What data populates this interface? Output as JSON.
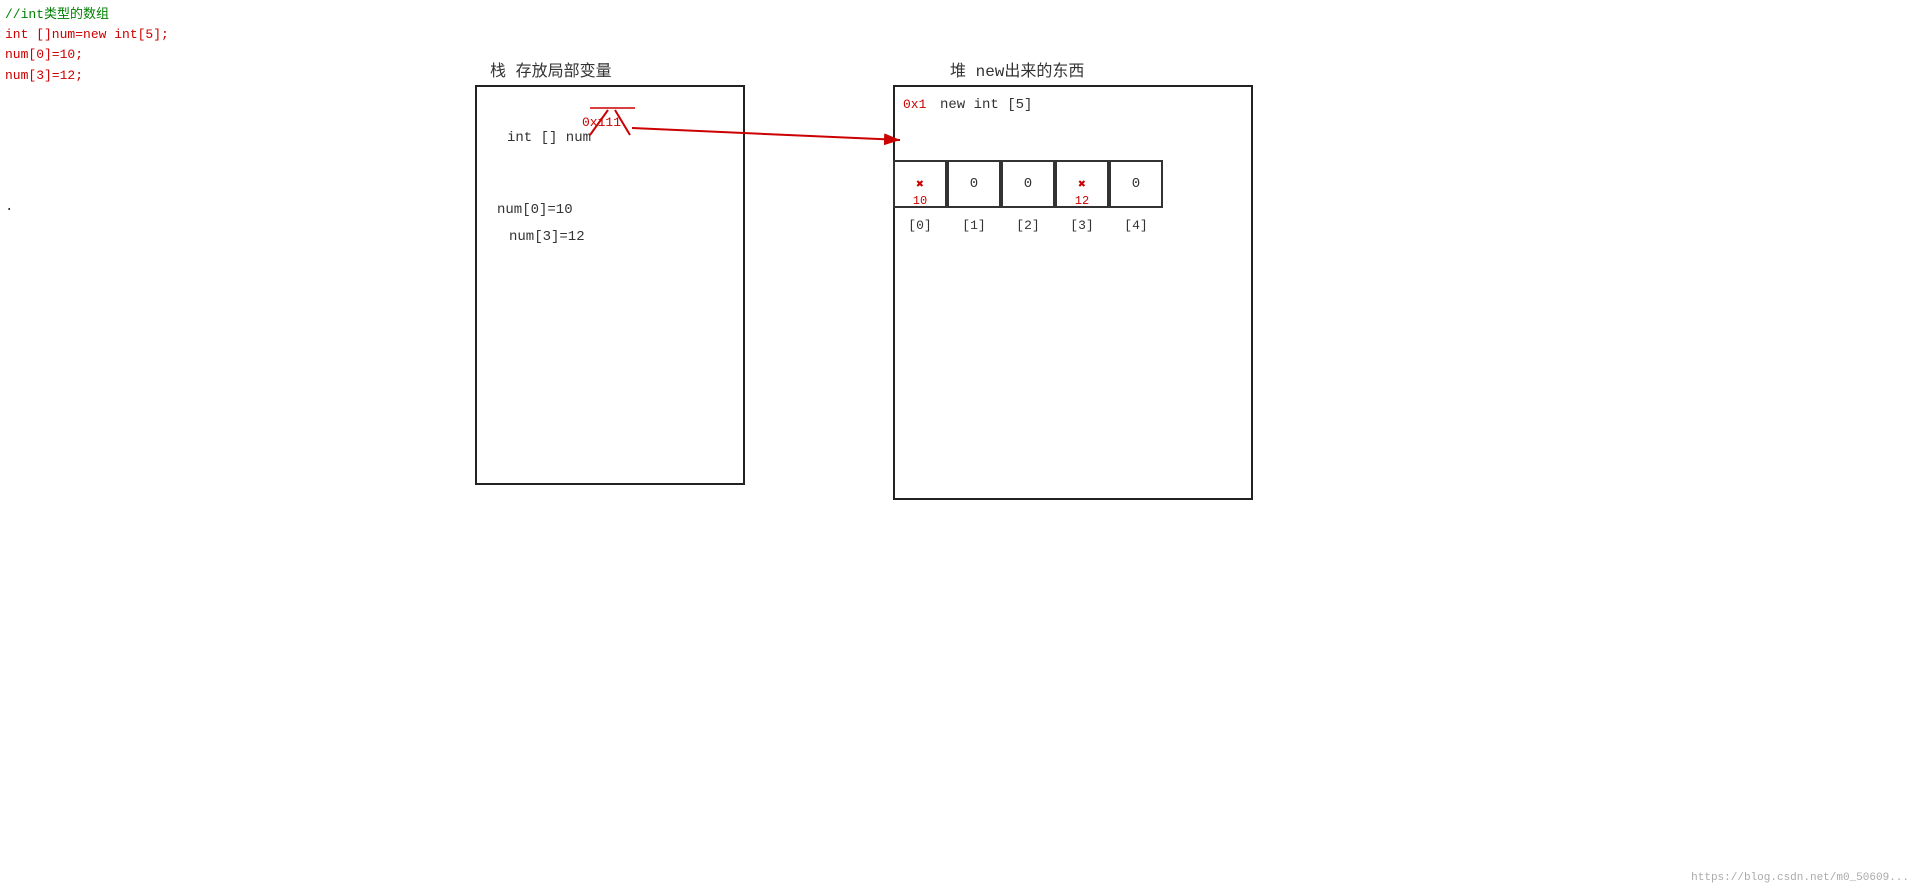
{
  "code": {
    "comment": "//int类型的数组",
    "line1": "int []num=new int[5];",
    "line2": "num[0]=10;",
    "line3": "num[3]=12;"
  },
  "stack": {
    "label": "栈  存放局部变量",
    "var_name": "int [] num",
    "addr": "0x111",
    "val1": "num[0]=10",
    "val2": "num[3]=12"
  },
  "heap": {
    "label": "堆  new出来的东西",
    "addr": "0x1",
    "title": "new int [5]",
    "cells": [
      {
        "value": "0",
        "annotation": "10",
        "has_annotation": true
      },
      {
        "value": "0",
        "annotation": "",
        "has_annotation": false
      },
      {
        "value": "0",
        "annotation": "",
        "has_annotation": false
      },
      {
        "value": "0",
        "annotation": "12",
        "has_annotation": true
      },
      {
        "value": "0",
        "annotation": "",
        "has_annotation": false
      }
    ],
    "indices": [
      "[0]",
      "[1]",
      "[2]",
      "[3]",
      "[4]"
    ]
  },
  "watermark": "https://blog.csdn.net/m0_50609..."
}
